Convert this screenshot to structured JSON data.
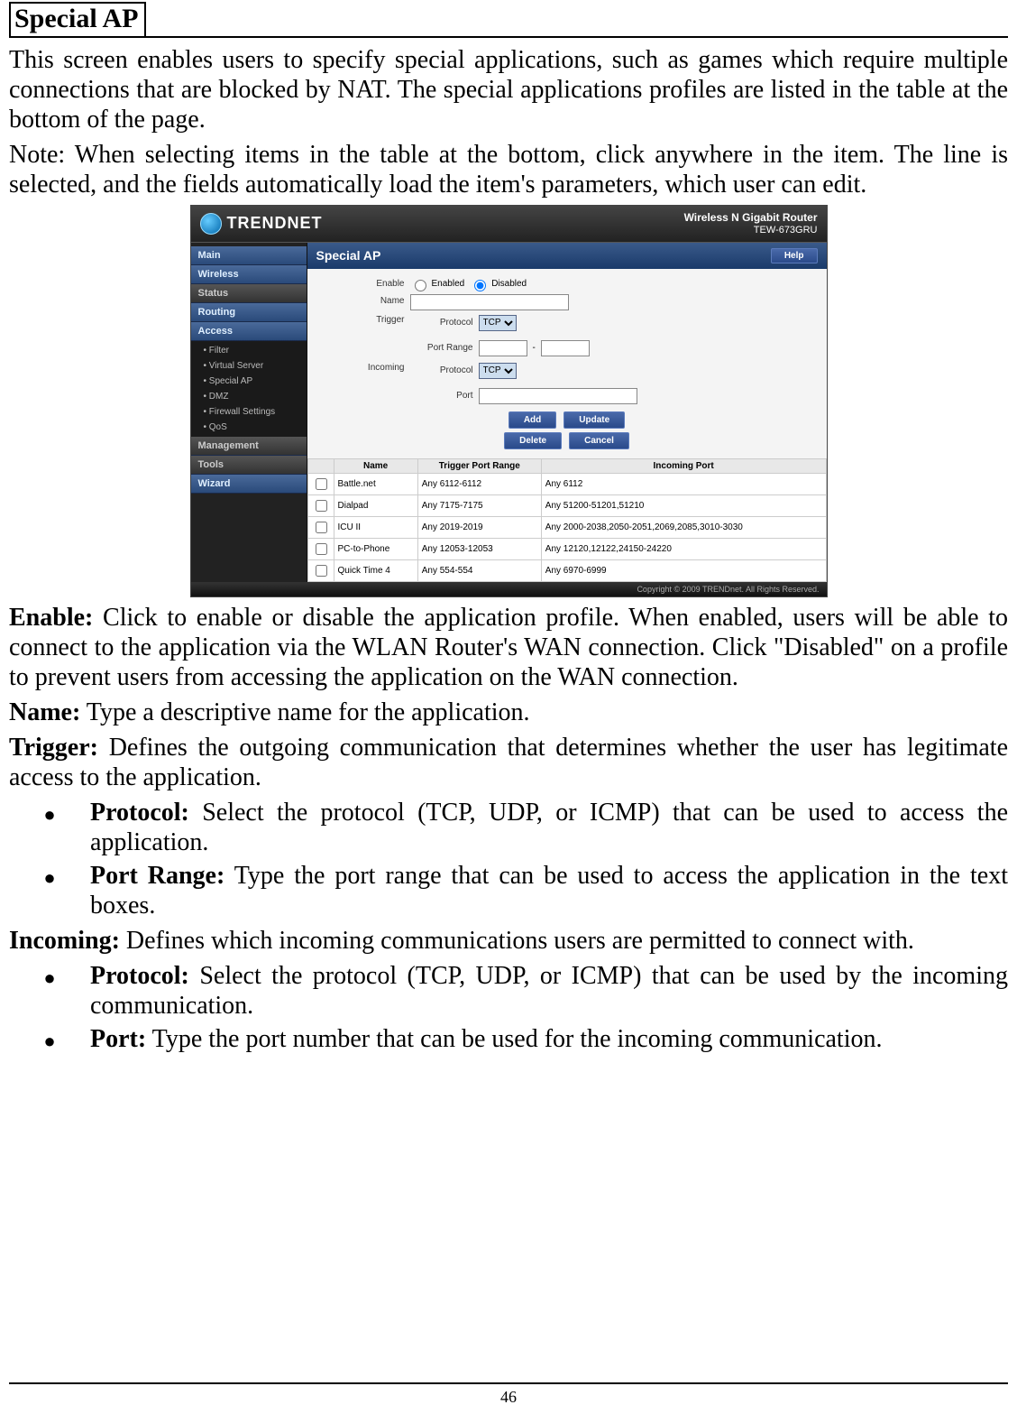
{
  "page_number": "46",
  "section_title": "Special AP",
  "intro1": "This screen enables users to specify special applications, such as games which require multiple connections that are blocked by NAT. The special applications profiles are listed in the table at the bottom of the page.",
  "intro2": "Note: When selecting items in the table at the bottom, click anywhere in the item. The line is selected, and the fields automatically load the item's parameters, which user can edit.",
  "fields": {
    "enable": {
      "term": "Enable:",
      "text": " Click to enable or disable the application profile. When enabled, users will be able to connect to the application via the WLAN Router's WAN connection. Click \"Disabled\" on a profile to prevent users from accessing the application on the WAN connection."
    },
    "name": {
      "term": "Name:",
      "text": " Type a descriptive name for the application."
    },
    "trigger": {
      "term": "Trigger:",
      "text": " Defines the outgoing communication that determines whether the user has legitimate access to the application.",
      "bullets": [
        {
          "term": "Protocol:",
          "text": " Select the protocol (TCP, UDP, or ICMP) that can be used to access the application."
        },
        {
          "term": "Port Range:",
          "text": " Type the port range that can be used to access the application in the text boxes."
        }
      ]
    },
    "incoming": {
      "term": "Incoming:",
      "text": " Defines which incoming communications users are permitted to connect with.",
      "bullets": [
        {
          "term": "Protocol:",
          "text": " Select the protocol (TCP, UDP, or ICMP) that can be used by the incoming communication."
        },
        {
          "term": "Port:",
          "text": " Type the port number that can be used for the incoming communication."
        }
      ]
    }
  },
  "shot": {
    "brand": "TRENDNET",
    "model_line1": "Wireless N Gigabit Router",
    "model_line2": "TEW-673GRU",
    "nav": {
      "main": "Main",
      "wireless": "Wireless",
      "status": "Status",
      "routing": "Routing",
      "access": "Access",
      "sub": [
        "• Filter",
        "• Virtual Server",
        "• Special AP",
        "• DMZ",
        "• Firewall Settings",
        "• QoS"
      ],
      "management": "Management",
      "tools": "Tools",
      "wizard": "Wizard"
    },
    "panel_title": "Special AP",
    "help": "Help",
    "form": {
      "enable_label": "Enable",
      "enabled_opt": "Enabled",
      "disabled_opt": "Disabled",
      "name_label": "Name",
      "trigger_label": "Trigger",
      "incoming_label": "Incoming",
      "protocol_label": "Protocol",
      "protocol_value": "TCP",
      "port_range_label": "Port Range",
      "port_label": "Port",
      "dash": "-",
      "btn_add": "Add",
      "btn_update": "Update",
      "btn_delete": "Delete",
      "btn_cancel": "Cancel"
    },
    "table": {
      "headers": [
        "",
        "Name",
        "Trigger Port Range",
        "Incoming Port"
      ],
      "rows": [
        [
          "Battle.net",
          "Any 6112-6112",
          "Any 6112"
        ],
        [
          "Dialpad",
          "Any 7175-7175",
          "Any 51200-51201,51210"
        ],
        [
          "ICU II",
          "Any 2019-2019",
          "Any 2000-2038,2050-2051,2069,2085,3010-3030"
        ],
        [
          "PC-to-Phone",
          "Any 12053-12053",
          "Any 12120,12122,24150-24220"
        ],
        [
          "Quick Time 4",
          "Any 554-554",
          "Any 6970-6999"
        ]
      ]
    },
    "copyright": "Copyright © 2009 TRENDnet. All Rights Reserved."
  }
}
